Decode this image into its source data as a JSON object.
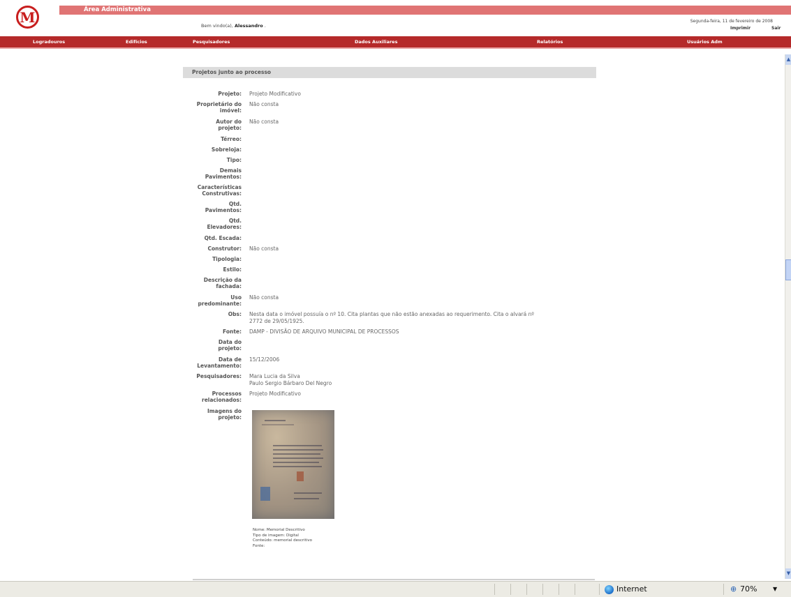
{
  "header": {
    "logo_letter": "M",
    "area_title": "Área Administrativa",
    "welcome_prefix": "Bem vindo(a),",
    "user_name": "Alessandro",
    "welcome_suffix": ".",
    "date": "Segunda-feira, 11 de fevereiro de 2008",
    "print_label": "Imprimir",
    "logout_label": "Sair"
  },
  "menu": {
    "items": [
      "Logradouros",
      "Edifícios",
      "Pesquisadores",
      "Dados Auxiliares",
      "Relatórios",
      "Usuários Adm"
    ]
  },
  "section": {
    "title": "Projetos junto ao processo"
  },
  "fields": [
    {
      "label": "Projeto:",
      "value": "Projeto Modificativo"
    },
    {
      "label": "Proprietário do imóvel:",
      "value": "Não consta"
    },
    {
      "label": "Autor do projeto:",
      "value": "Não consta"
    },
    {
      "label": "Térreo:",
      "value": ""
    },
    {
      "label": "Sobreloja:",
      "value": ""
    },
    {
      "label": "Tipo:",
      "value": ""
    },
    {
      "label": "Demais Pavimentos:",
      "value": ""
    },
    {
      "label": "Características Construtivas:",
      "value": ""
    },
    {
      "label": "Qtd. Pavimentos:",
      "value": ""
    },
    {
      "label": "Qtd. Elevadores:",
      "value": ""
    },
    {
      "label": "Qtd. Escada:",
      "value": ""
    },
    {
      "label": "Construtor:",
      "value": "Não consta"
    },
    {
      "label": "Tipologia:",
      "value": ""
    },
    {
      "label": "Estilo:",
      "value": ""
    },
    {
      "label": "Descrição da fachada:",
      "value": ""
    },
    {
      "label": "Uso predominante:",
      "value": "Não consta"
    },
    {
      "label": "Obs:",
      "value": "Nesta data o imóvel possuía o nº 10. Cita plantas que não estão anexadas ao requerimento. Cita o alvará nº 2772 de 29/05/1925."
    },
    {
      "label": "Fonte:",
      "value": "DAMP - DIVISÃO DE ARQUIVO MUNICIPAL DE PROCESSOS"
    },
    {
      "label": "Data do projeto:",
      "value": ""
    },
    {
      "label": "Data de Levantamento:",
      "value": "15/12/2006"
    },
    {
      "label": "Pesquisadores:",
      "value": "Mara Lucia da Silva\nPaulo Sergio Bárbaro Del Negro"
    },
    {
      "label": "Processos relacionados:",
      "value": "Projeto Modificativo"
    },
    {
      "label": "Imagens do projeto:",
      "value": ""
    }
  ],
  "image_caption": {
    "name": "Nome: Memorial Descritivo",
    "type": "Tipo de imagem: Digital",
    "content": "Conteúdo: memorial descritivo",
    "source": "Fonte:"
  },
  "statusbar": {
    "zone": "Internet",
    "zoom": "70%"
  },
  "colors": {
    "brand_red": "#b52a2a",
    "band_pink": "#e07474",
    "section_gray": "#dcdcdc"
  }
}
